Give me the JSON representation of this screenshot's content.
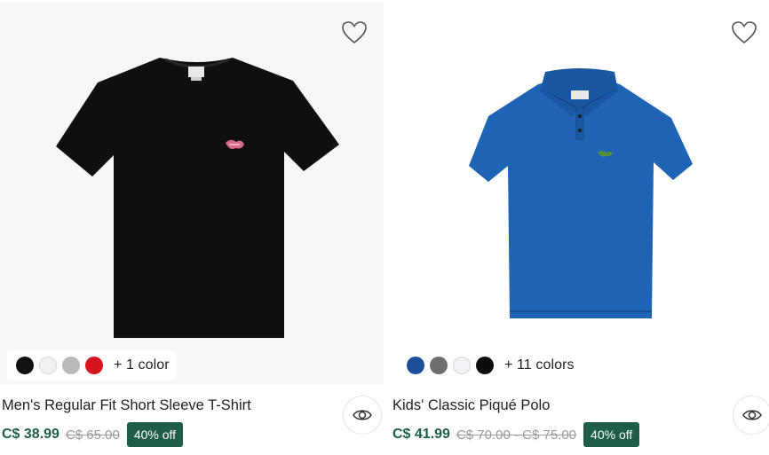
{
  "products": [
    {
      "name": "Men's Regular Fit Short Sleeve T-Shirt",
      "price": "C$ 38.99",
      "original_price": "C$ 65.00",
      "discount": "40% off",
      "more_colors": "+ 1 color",
      "image_icon": "black-tshirt-image",
      "swatches": [
        "#111111",
        "#f1f1f4",
        "#b9b9bc",
        "#d8141e"
      ]
    },
    {
      "name": "Kids' Classic Piqué Polo",
      "price": "C$ 41.99",
      "original_price": "C$ 70.00 - C$ 75.00",
      "discount": "40% off",
      "more_colors": "+ 11 colors",
      "image_icon": "blue-polo-image",
      "swatches": [
        "#1c4f9a",
        "#6e6e72",
        "#f1f2f6",
        "#0c0c0c"
      ]
    }
  ],
  "icons": {
    "wishlist": "heart-icon",
    "quick_view": "eye-icon"
  },
  "colors": {
    "accent": "#1e5e48"
  }
}
